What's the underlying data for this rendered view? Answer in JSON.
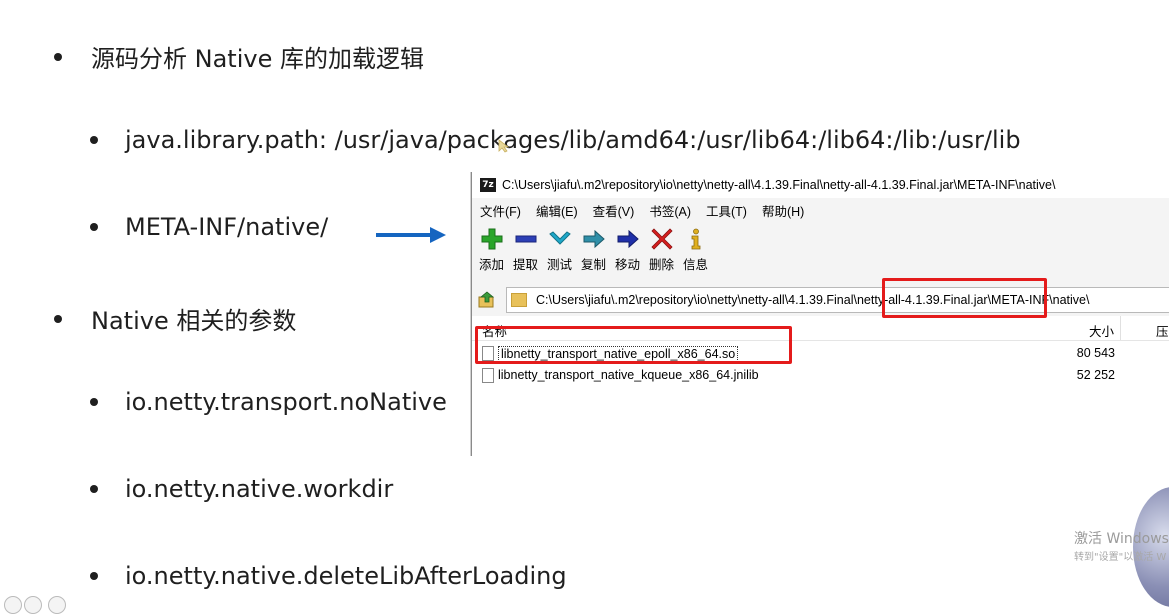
{
  "slide": {
    "bullets": [
      {
        "level": 1,
        "text": "源码分析 Native 库的加载逻辑"
      },
      {
        "level": 2,
        "text": "java.library.path: /usr/java/packages/lib/amd64:/usr/lib64:/lib64:/lib:/usr/lib"
      },
      {
        "level": 2,
        "text": "META-INF/native/"
      },
      {
        "level": 1,
        "text": "Native 相关的参数"
      },
      {
        "level": 2,
        "text": "io.netty.transport.noNative"
      },
      {
        "level": 2,
        "text": "io.netty.native.workdir"
      },
      {
        "level": 2,
        "text": "io.netty.native.deleteLibAfterLoading"
      }
    ],
    "arrow_color": "#1565c0",
    "highlight_color": "#e41b1b"
  },
  "window": {
    "app_icon": "7z",
    "title": "C:\\Users\\jiafu\\.m2\\repository\\io\\netty\\netty-all\\4.1.39.Final\\netty-all-4.1.39.Final.jar\\META-INF\\native\\",
    "menu": [
      "文件(F)",
      "编辑(E)",
      "查看(V)",
      "书签(A)",
      "工具(T)",
      "帮助(H)"
    ],
    "toolbar": [
      {
        "label": "添加",
        "icon": "add-plus-icon"
      },
      {
        "label": "提取",
        "icon": "extract-minus-icon"
      },
      {
        "label": "测试",
        "icon": "test-check-icon"
      },
      {
        "label": "复制",
        "icon": "copy-arrow-icon"
      },
      {
        "label": "移动",
        "icon": "move-arrow-icon"
      },
      {
        "label": "删除",
        "icon": "delete-x-icon"
      },
      {
        "label": "信息",
        "icon": "info-icon"
      }
    ],
    "address": "C:\\Users\\jiafu\\.m2\\repository\\io\\netty\\netty-all\\4.1.39.Final\\netty-all-4.1.39.Final.jar\\META-INF\\native\\",
    "columns": {
      "name": "名称",
      "size": "大小",
      "packed": "压"
    },
    "files": [
      {
        "name": "libnetty_transport_native_epoll_x86_64.so",
        "size": "80 543"
      },
      {
        "name": "libnetty_transport_native_kqueue_x86_64.jnilib",
        "size": "52 252"
      }
    ]
  },
  "watermark": {
    "line1": "激活 Windows",
    "line2": "转到\"设置\"以激活 W"
  }
}
